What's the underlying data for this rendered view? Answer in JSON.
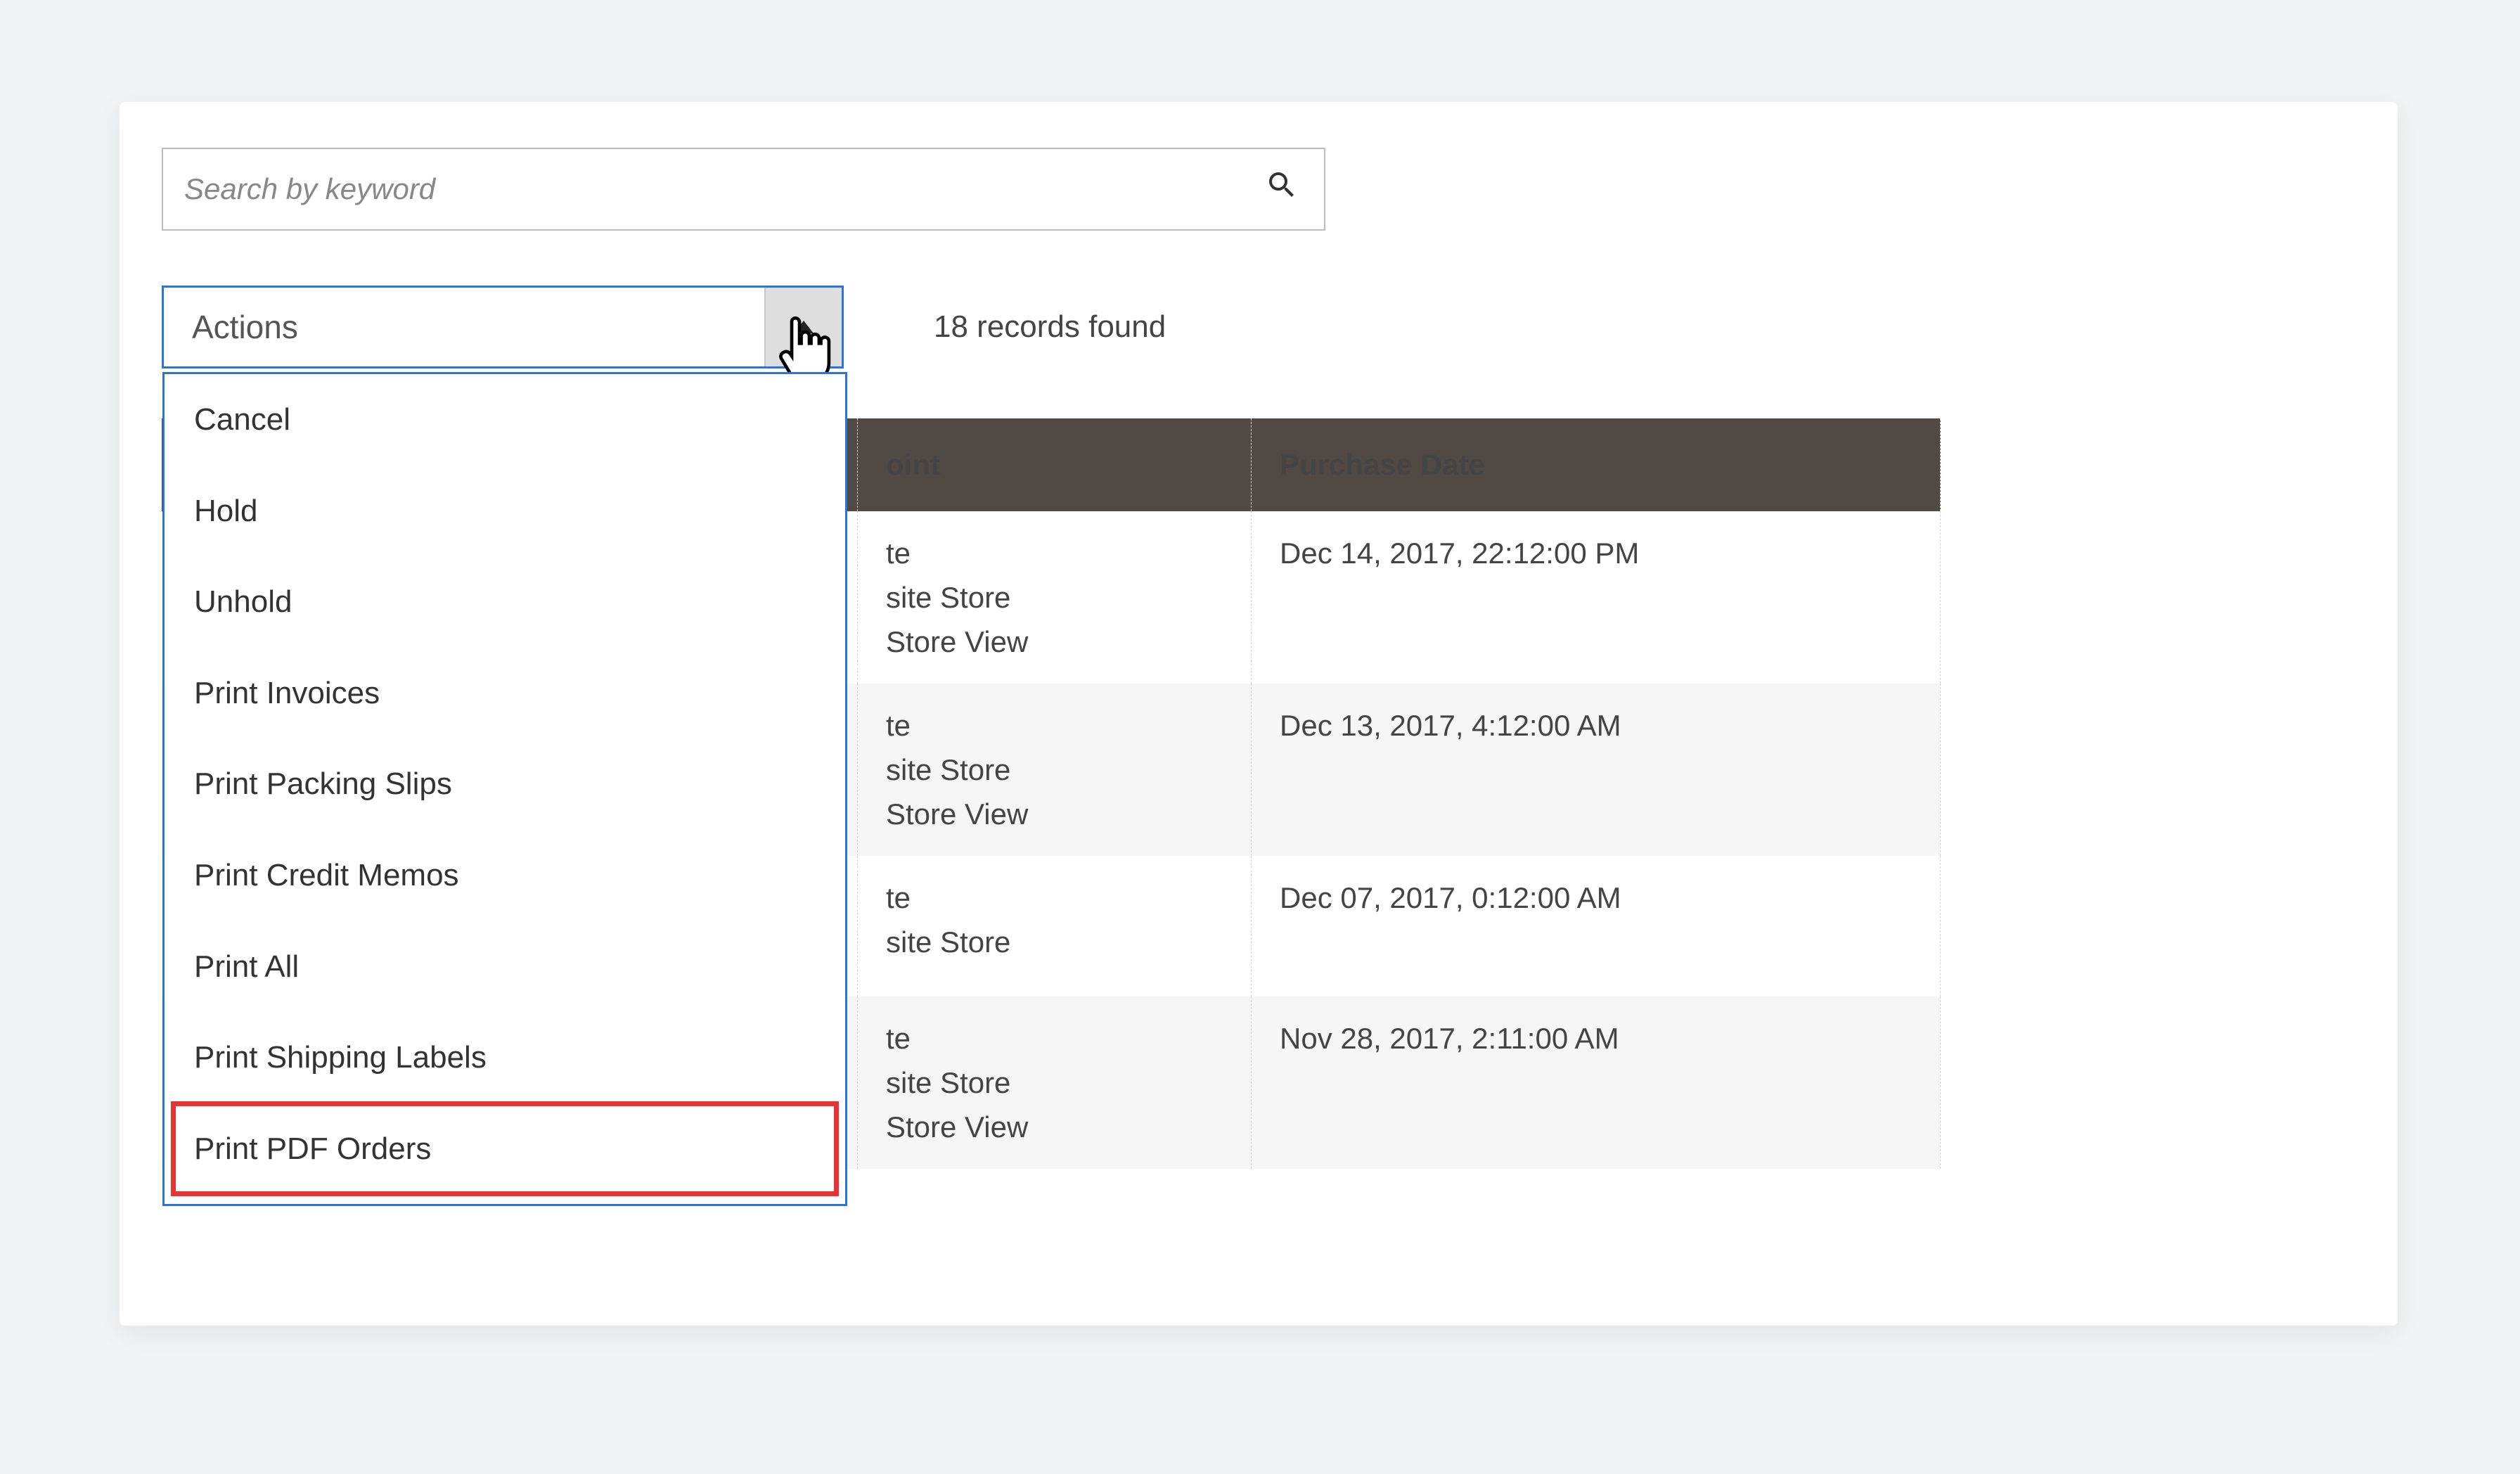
{
  "search": {
    "placeholder": "Search by keyword"
  },
  "actions": {
    "label": "Actions",
    "items": [
      "Cancel",
      "Hold",
      "Unhold",
      "Print Invoices",
      "Print Packing Slips",
      "Print Credit Memos",
      "Print All",
      "Print Shipping Labels",
      "Print PDF Orders"
    ],
    "highlight_index": 8
  },
  "records_found": "18 records found",
  "table": {
    "headers": {
      "purchase_point": "oint",
      "purchase_date": "Purchase Date"
    },
    "rows": [
      {
        "point_lines": [
          "te",
          "site Store",
          "Store View"
        ],
        "purchase_date": "Dec 14, 2017, 22:12:00 PM"
      },
      {
        "point_lines": [
          "te",
          "site Store",
          "Store View"
        ],
        "purchase_date": "Dec 13, 2017, 4:12:00 AM"
      },
      {
        "point_lines": [
          "te",
          "site Store"
        ],
        "purchase_date": "Dec 07, 2017, 0:12:00 AM"
      },
      {
        "point_lines": [
          "te",
          "site Store",
          "Store View"
        ],
        "purchase_date": "Nov 28, 2017, 2:11:00 AM"
      }
    ]
  }
}
